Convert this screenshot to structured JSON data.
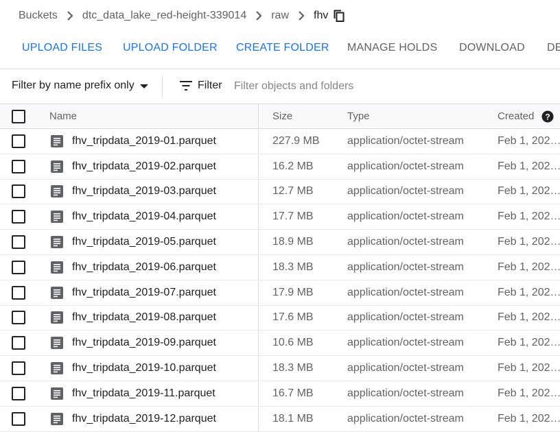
{
  "breadcrumb": {
    "items": [
      "Buckets",
      "dtc_data_lake_red-height-339014",
      "raw"
    ],
    "current": "fhv",
    "copy_icon": "copy-icon"
  },
  "actions": {
    "upload_files": "UPLOAD FILES",
    "upload_folder": "UPLOAD FOLDER",
    "create_folder": "CREATE FOLDER",
    "manage_holds": "MANAGE HOLDS",
    "download": "DOWNLOAD",
    "delete_partial": "DE"
  },
  "filter": {
    "prefix_label": "Filter by name prefix only",
    "label": "Filter",
    "placeholder": "Filter objects and folders",
    "value": ""
  },
  "table": {
    "columns": {
      "name": "Name",
      "size": "Size",
      "type": "Type",
      "created": "Created"
    },
    "rows": [
      {
        "name": "fhv_tripdata_2019-01.parquet",
        "size": "227.9 MB",
        "type": "application/octet-stream",
        "created": "Feb 1, 202…"
      },
      {
        "name": "fhv_tripdata_2019-02.parquet",
        "size": "16.2 MB",
        "type": "application/octet-stream",
        "created": "Feb 1, 202…"
      },
      {
        "name": "fhv_tripdata_2019-03.parquet",
        "size": "12.7 MB",
        "type": "application/octet-stream",
        "created": "Feb 1, 202…"
      },
      {
        "name": "fhv_tripdata_2019-04.parquet",
        "size": "17.7 MB",
        "type": "application/octet-stream",
        "created": "Feb 1, 202…"
      },
      {
        "name": "fhv_tripdata_2019-05.parquet",
        "size": "18.9 MB",
        "type": "application/octet-stream",
        "created": "Feb 1, 202…"
      },
      {
        "name": "fhv_tripdata_2019-06.parquet",
        "size": "18.3 MB",
        "type": "application/octet-stream",
        "created": "Feb 1, 202…"
      },
      {
        "name": "fhv_tripdata_2019-07.parquet",
        "size": "17.9 MB",
        "type": "application/octet-stream",
        "created": "Feb 1, 202…"
      },
      {
        "name": "fhv_tripdata_2019-08.parquet",
        "size": "17.6 MB",
        "type": "application/octet-stream",
        "created": "Feb 1, 202…"
      },
      {
        "name": "fhv_tripdata_2019-09.parquet",
        "size": "10.6 MB",
        "type": "application/octet-stream",
        "created": "Feb 1, 202…"
      },
      {
        "name": "fhv_tripdata_2019-10.parquet",
        "size": "18.3 MB",
        "type": "application/octet-stream",
        "created": "Feb 1, 202…"
      },
      {
        "name": "fhv_tripdata_2019-11.parquet",
        "size": "16.7 MB",
        "type": "application/octet-stream",
        "created": "Feb 1, 202…"
      },
      {
        "name": "fhv_tripdata_2019-12.parquet",
        "size": "18.1 MB",
        "type": "application/octet-stream",
        "created": "Feb 1, 202…"
      }
    ]
  },
  "colors": {
    "accent": "#1a73e8",
    "text": "#202124",
    "muted": "#5f6368",
    "divider": "#dadce0"
  }
}
